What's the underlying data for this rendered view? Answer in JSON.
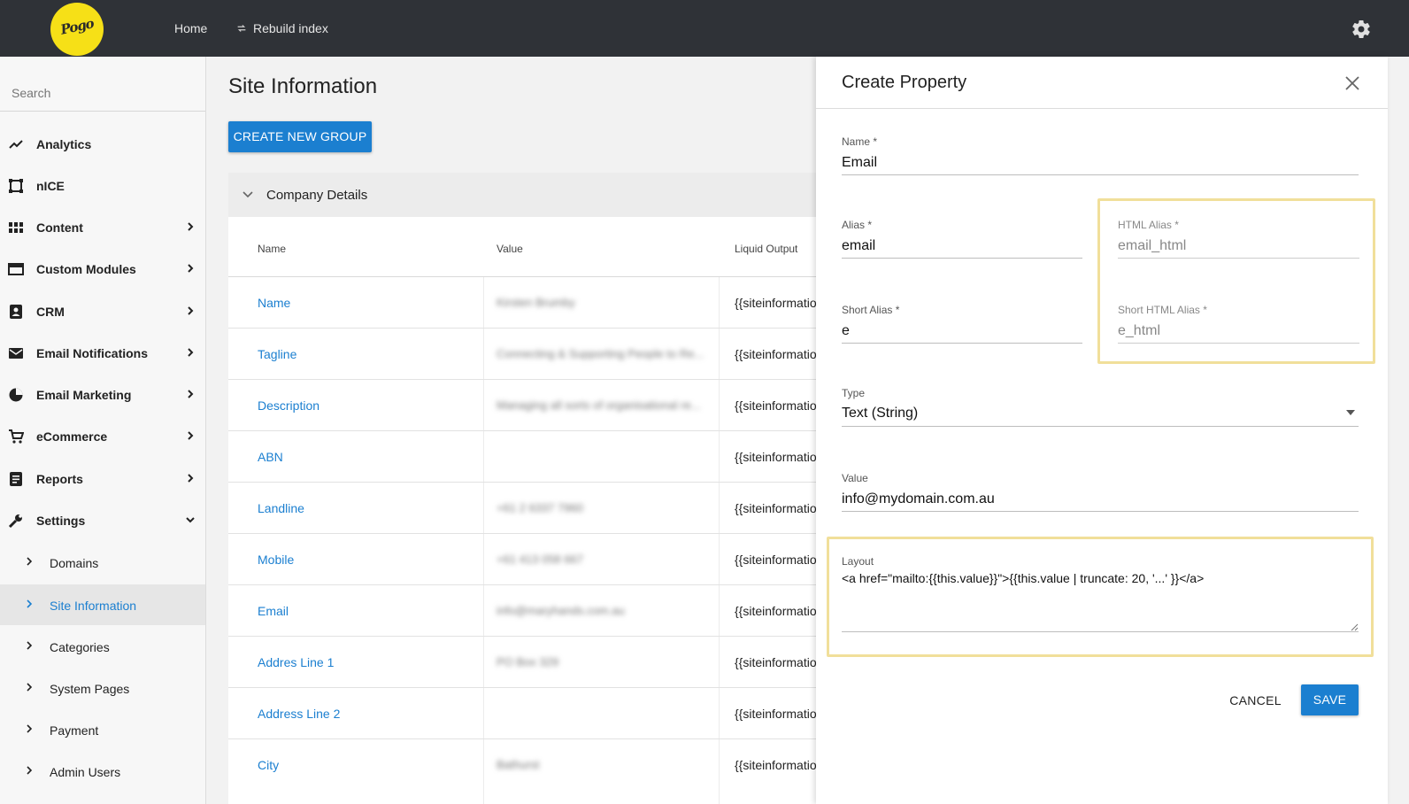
{
  "topbar": {
    "logo_text": "Pogo",
    "nav": [
      "Home",
      "Rebuild index"
    ],
    "icons": {
      "rebuild": "refresh-icon",
      "settings": "gear-icon"
    }
  },
  "sidebar": {
    "search_placeholder": "Search",
    "items": [
      {
        "label": "Analytics",
        "icon": "trend-icon",
        "has_children": false
      },
      {
        "label": "nICE",
        "icon": "frame-icon",
        "has_children": false
      },
      {
        "label": "Content",
        "icon": "grid-icon",
        "has_children": true
      },
      {
        "label": "Custom Modules",
        "icon": "module-icon",
        "has_children": true
      },
      {
        "label": "CRM",
        "icon": "contact-icon",
        "has_children": true
      },
      {
        "label": "Email Notifications",
        "icon": "mail-icon",
        "has_children": true
      },
      {
        "label": "Email Marketing",
        "icon": "pie-icon",
        "has_children": true
      },
      {
        "label": "eCommerce",
        "icon": "cart-icon",
        "has_children": true
      },
      {
        "label": "Reports",
        "icon": "report-icon",
        "has_children": true
      },
      {
        "label": "Settings",
        "icon": "wrench-icon",
        "has_children": true,
        "expanded": true
      }
    ],
    "subitems": [
      {
        "label": "Domains",
        "active": false
      },
      {
        "label": "Site Information",
        "active": true
      },
      {
        "label": "Categories",
        "active": false
      },
      {
        "label": "System Pages",
        "active": false
      },
      {
        "label": "Payment",
        "active": false
      },
      {
        "label": "Admin Users",
        "active": false
      }
    ]
  },
  "main": {
    "title": "Site Information",
    "create_group_button": "CREATE NEW GROUP",
    "group": "Company Details",
    "columns": [
      "Name",
      "Value",
      "Liquid Output"
    ],
    "rows": [
      {
        "name": "Name",
        "value": "Kirsten Brumby",
        "liquid": "{{siteinformatio"
      },
      {
        "name": "Tagline",
        "value": "Connecting & Supporting People to Re...",
        "liquid": "{{siteinformatio"
      },
      {
        "name": "Description",
        "value": "Managing all sorts of organisational re...",
        "liquid": "{{siteinformatio"
      },
      {
        "name": "ABN",
        "value": "",
        "liquid": "{{siteinformatio"
      },
      {
        "name": "Landline",
        "value": "+61 2 6337 7960",
        "liquid": "{{siteinformatio"
      },
      {
        "name": "Mobile",
        "value": "+61 413 058 667",
        "liquid": "{{siteinformatio"
      },
      {
        "name": "Email",
        "value": "info@maryhands.com.au",
        "liquid": "{{siteinformatio"
      },
      {
        "name": "Addres Line 1",
        "value": "PO Box 329",
        "liquid": "{{siteinformatio"
      },
      {
        "name": "Address Line 2",
        "value": "",
        "liquid": "{{siteinformatio"
      },
      {
        "name": "City",
        "value": "Bathurst",
        "liquid": "{{siteinformatio"
      }
    ]
  },
  "dialog": {
    "title": "Create Property",
    "close_icon": "close-icon",
    "name": {
      "label": "Name *",
      "value": "Email"
    },
    "alias": {
      "label": "Alias *",
      "value": "email"
    },
    "html_alias": {
      "label": "HTML Alias *",
      "value": "email_html"
    },
    "short_alias": {
      "label": "Short Alias *",
      "value": "e"
    },
    "short_html_alias": {
      "label": "Short HTML Alias *",
      "value": "e_html"
    },
    "type": {
      "label": "Type",
      "value": "Text (String)"
    },
    "value": {
      "label": "Value",
      "value": "info@mydomain.com.au"
    },
    "layout": {
      "label": "Layout",
      "value": "<a href=\"mailto:{{this.value}}\">{{this.value | truncate: 20, '...' }}</a>"
    },
    "cancel_button": "CANCEL",
    "save_button": "SAVE",
    "highlight_color": "#f1df9a"
  },
  "colors": {
    "accent": "#1b7fd0",
    "topbar": "#2f3237",
    "logo": "#f6e017"
  }
}
